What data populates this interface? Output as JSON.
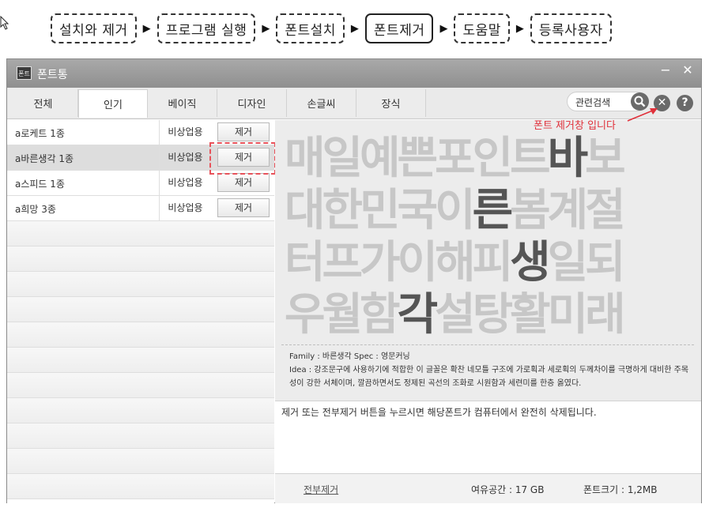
{
  "steps": [
    {
      "label": "설치와 제거"
    },
    {
      "label": "프로그램 실행"
    },
    {
      "label": "폰트설치"
    },
    {
      "label": "폰트제거",
      "active": true
    },
    {
      "label": "도움말"
    },
    {
      "label": "등록사용자"
    }
  ],
  "window": {
    "title": "폰트통",
    "icon_label": "폰트",
    "minimize": "−",
    "close": "✕"
  },
  "tabs": [
    "전체",
    "인기",
    "베이직",
    "디자인",
    "손글씨",
    "장식"
  ],
  "active_tab": "인기",
  "search": {
    "placeholder": "관련검색",
    "value": "관련검색"
  },
  "clear_icon": "✕",
  "help_icon": "?",
  "fonts": [
    {
      "name": "a로케트 1종",
      "type": "비상업용",
      "button": "제거"
    },
    {
      "name": "a바른생각 1종",
      "type": "비상업용",
      "button": "제거",
      "selected": true
    },
    {
      "name": "a스피드 1종",
      "type": "비상업용",
      "button": "제거"
    },
    {
      "name": "a희망 3종",
      "type": "비상업용",
      "button": "제거"
    }
  ],
  "annotation": "폰트 제거창 입니다",
  "preview": {
    "lines": [
      {
        "pre": "매일예쁜포인트",
        "hl": "바",
        "post": "보"
      },
      {
        "pre": "대한민국이",
        "hl": "른",
        "post": "봄계절"
      },
      {
        "pre": "터프가이해피",
        "hl": "생",
        "post": "일되"
      },
      {
        "pre": "우월함",
        "hl": "각",
        "post": "설탕활미래"
      }
    ],
    "family_line": "Family : 바른생각   Spec : 영문커닝",
    "idea_line": "Idea : 강조문구에 사용하기에 적합한 이 글꼴은 확찬 네모틀 구조에 가로획과 세로획의 두께차이를 극명하게 대비한 주목성이 강한 서체이며, 깔끔하면서도 정제된 곡선의 조화로 시원함과 세련미를 한층 옳였다."
  },
  "description": "제거 또는 전부제거 버튼을 누르시면 해당폰트가 컴퓨터에서 완전히 삭제됩니다.",
  "status": {
    "remove_all": "전부제거",
    "free_space": "여유공간 :   17 GB",
    "font_size": "폰트크기 :   1,2MB"
  },
  "colors": {
    "accent": "#e0303a",
    "titlebar": "#9a9a9a",
    "highlight_text": "#555555",
    "dim_text": "#c7c7c7"
  }
}
